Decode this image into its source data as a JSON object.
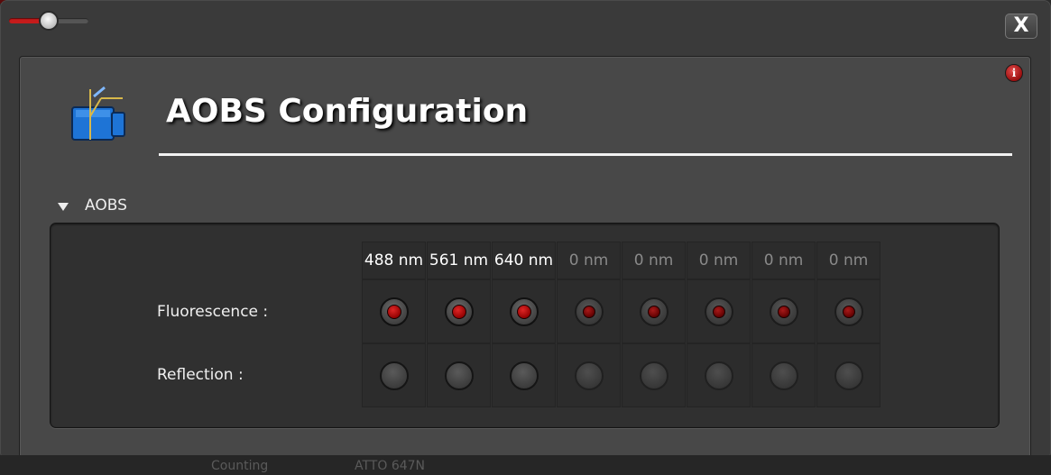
{
  "window": {
    "title": "AOBS Configuration",
    "close_label": "X",
    "info_label": "i"
  },
  "colors": {
    "accent": "#c51b1b",
    "dialog_bg": "#484848",
    "panel_bg": "#303030"
  },
  "opacity_slider": {
    "level_fraction": 0.45
  },
  "section": {
    "label": "AOBS",
    "expanded": true
  },
  "channels": [
    {
      "label": "488 nm",
      "active": true
    },
    {
      "label": "561 nm",
      "active": true
    },
    {
      "label": "640 nm",
      "active": true
    },
    {
      "label": "0 nm",
      "active": false
    },
    {
      "label": "0 nm",
      "active": false
    },
    {
      "label": "0 nm",
      "active": false
    },
    {
      "label": "0 nm",
      "active": false
    },
    {
      "label": "0 nm",
      "active": false
    }
  ],
  "rows": {
    "fluorescence_label": "Fluorescence :",
    "reflection_label": "Reflection :"
  },
  "fluorescence_selected": [
    true,
    true,
    true,
    true,
    true,
    true,
    true,
    true
  ],
  "reflection_selected": [
    false,
    false,
    false,
    false,
    false,
    false,
    false,
    false
  ],
  "background": {
    "bottom_left_text": "Counting",
    "bottom_mid_text": "ATTO 647N"
  }
}
